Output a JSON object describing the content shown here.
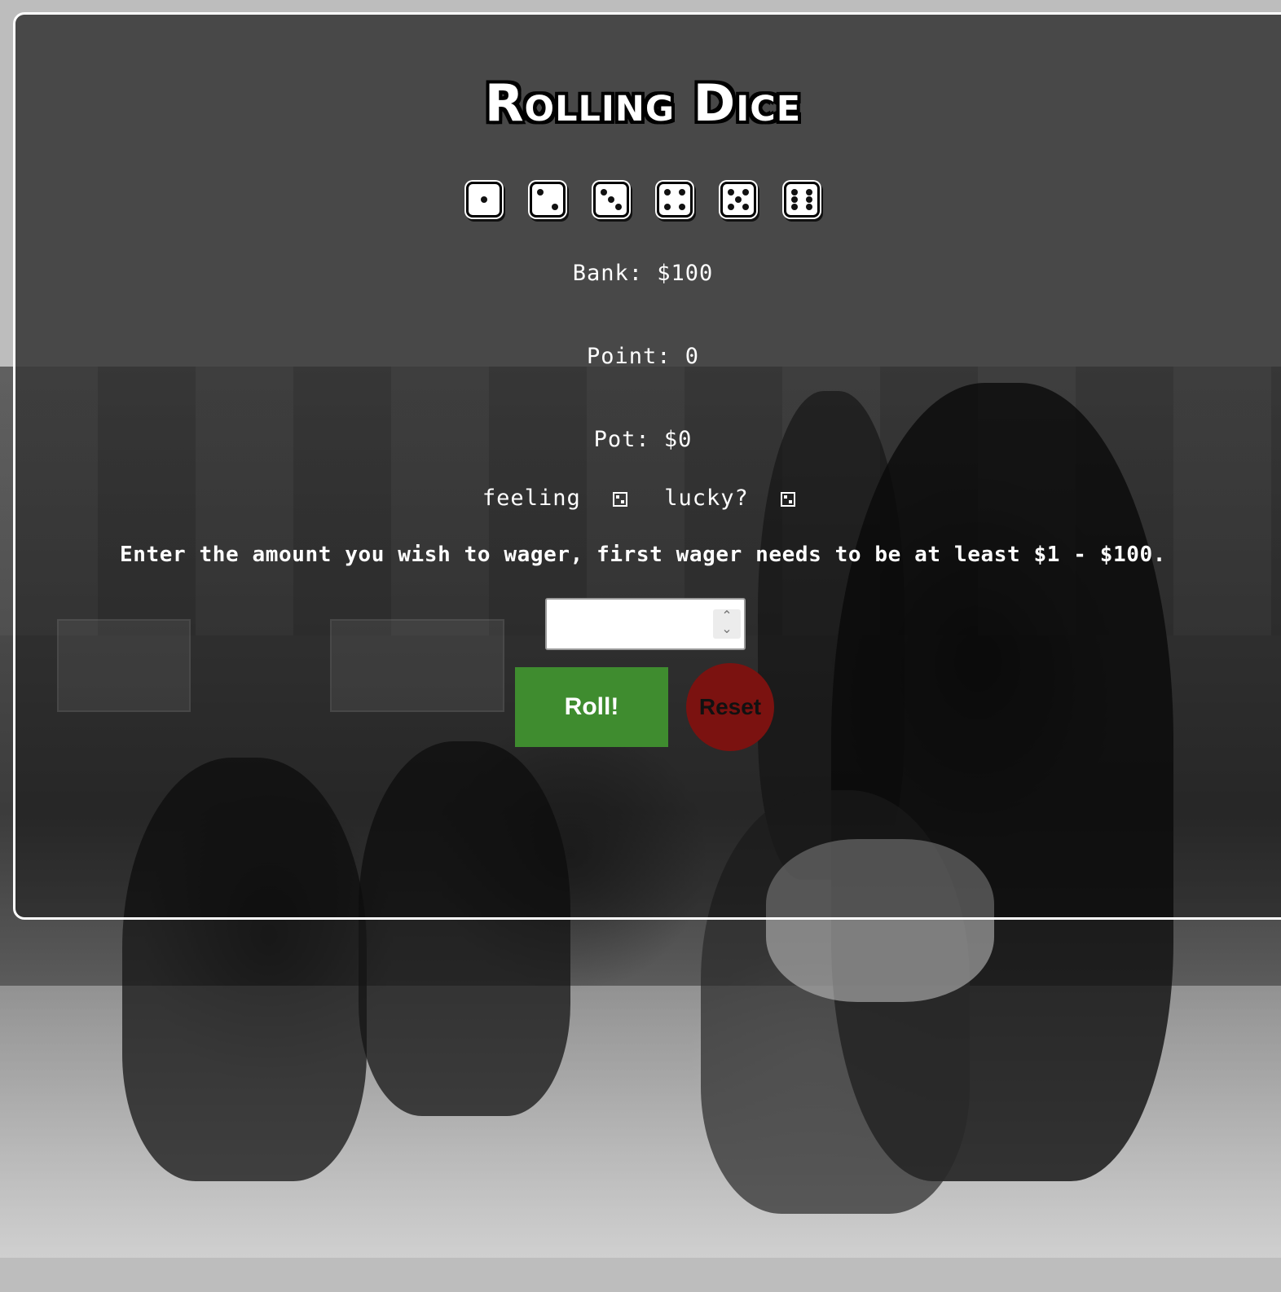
{
  "title": "Rolling Dice",
  "dice": [
    1,
    2,
    3,
    4,
    5,
    6
  ],
  "stats": {
    "bank": "Bank: $100",
    "point": "Point: 0",
    "pot": "Pot: $0"
  },
  "lucky": {
    "word1": "feeling",
    "word2": "lucky?"
  },
  "instruction": "Enter the amount you wish to wager, first wager needs to be at least $1 - $100.",
  "wager": {
    "value": "",
    "placeholder": ""
  },
  "buttons": {
    "roll": "Roll!",
    "reset": "Reset"
  },
  "colors": {
    "panel": "#484848",
    "roll": "#3f8c2f",
    "reset": "#7b1210",
    "text": "#ffffff"
  }
}
